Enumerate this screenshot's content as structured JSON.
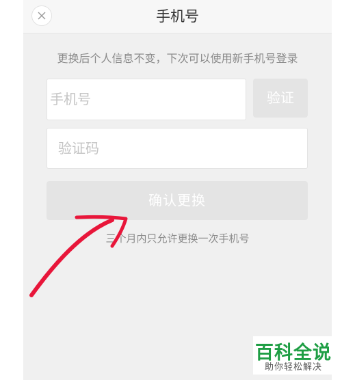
{
  "header": {
    "title": "手机号",
    "close_icon": "close-icon"
  },
  "hint_text": "更换后个人信息不变，下次可以使用新手机号登录",
  "form": {
    "phone_placeholder": "手机号",
    "verify_label": "验证",
    "code_placeholder": "验证码",
    "confirm_label": "确认更换"
  },
  "limit_note": "三个月内只允许更换一次手机号",
  "watermark": {
    "title": "百科全说",
    "subtitle": "助你轻松解决"
  },
  "colors": {
    "screen_bg": "#f0f0f0",
    "disabled_button": "#e4e4e4",
    "annotation_arrow": "#e8163a",
    "watermark_green": "#1e9e44"
  }
}
